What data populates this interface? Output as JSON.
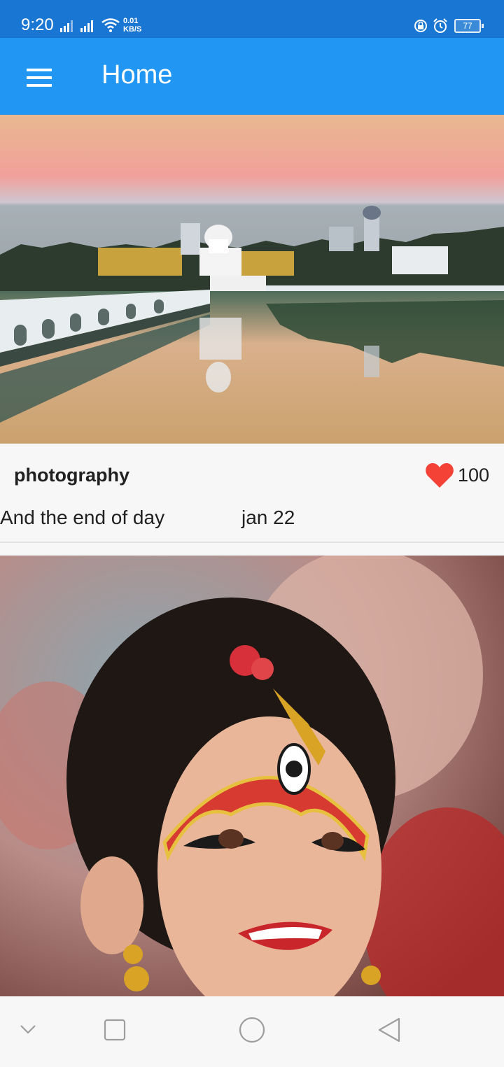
{
  "status_bar": {
    "time": "9:20",
    "net_speed_value": "0.01",
    "net_speed_unit": "KB/S",
    "battery": "77"
  },
  "app_bar": {
    "menu_icon": "hamburger-menu-icon",
    "title": "Home",
    "color": "#2196f3"
  },
  "posts": [
    {
      "image": "lake-temple-sunset-photo",
      "category": "photography",
      "likes": "100",
      "like_icon": "heart-icon",
      "like_color": "#f44336",
      "caption": "And the end of day",
      "date": "jan 22"
    },
    {
      "image": "girl-with-face-paint-photo"
    }
  ],
  "nav_bar": {
    "icons": [
      "chevron-down-icon",
      "recents-square-icon",
      "home-circle-icon",
      "back-triangle-icon"
    ]
  }
}
